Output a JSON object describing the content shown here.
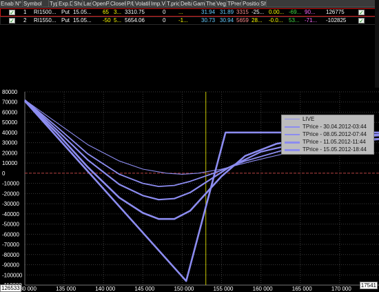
{
  "grid": {
    "headers": [
      "EnableN",
      "N°",
      "Symbol",
      "Type",
      "Exp.Date",
      "Share",
      "Last",
      "OpenPrice",
      "ClosePrice",
      "P/L",
      "Volatility",
      "Imp.Vol.",
      "T.price",
      "Delta",
      "Gamma",
      "Theta",
      "Vega",
      "TPremium",
      "Position",
      "Sh"
    ],
    "rows": [
      {
        "num": "1",
        "symbol": "RI1500...",
        "type": "Put",
        "exp": "15.05...",
        "share": "65",
        "last": "3...",
        "open": "3310.75",
        "close": "0",
        "pl": "...",
        "vol": "31.94",
        "impvol": "31.89",
        "tprice": "3315",
        "delta": "-25...",
        "gamma": "0.00...",
        "theta": "-69...",
        "vega": "90...",
        "tpremium": "126775"
      },
      {
        "num": "2",
        "symbol": "RI1550...",
        "type": "Put",
        "exp": "15.05...",
        "share": "-50",
        "last": "5...",
        "open": "5654.06",
        "close": "0",
        "pl": "-1...",
        "vol": "30.73",
        "impvol": "30.94",
        "tprice": "5659",
        "delta": "28...",
        "gamma": "-0.0...",
        "theta": "53...",
        "vega": "-71...",
        "tpremium": "-102825"
      }
    ]
  },
  "chart_data": {
    "type": "line",
    "x_range": [
      130000,
      175000
    ],
    "y_range": [
      -110000,
      80000
    ],
    "x_ticks": [
      "130 000",
      "135 000",
      "140 000",
      "145 000",
      "150 000",
      "155 000",
      "160 000",
      "165 000",
      "170 000"
    ],
    "x_tick_values": [
      130000,
      135000,
      140000,
      145000,
      150000,
      155000,
      160000,
      165000,
      170000
    ],
    "y_ticks": [
      "80000",
      "70000",
      "60000",
      "50000",
      "40000",
      "30000",
      "20000",
      "10000",
      "0",
      "-10000",
      "-20000",
      "-30000",
      "-40000",
      "-50000",
      "-60000",
      "-70000",
      "-80000",
      "-90000",
      "-100000",
      "-110000"
    ],
    "y_tick_values": [
      80000,
      70000,
      60000,
      50000,
      40000,
      30000,
      20000,
      10000,
      0,
      -10000,
      -20000,
      -30000,
      -40000,
      -50000,
      -60000,
      -70000,
      -80000,
      -90000,
      -100000,
      -110000
    ],
    "vertical_marker_x": 153000,
    "zero_line": 0,
    "cursor_x_label": "17541",
    "cursor_y_label": "126533",
    "legend_position": "top-right",
    "legend": [
      "LIVE",
      "TPrice - 30.04.2012-03:44",
      "TPrice - 08.05.2012-07:44",
      "TPrice - 11.05.2012-11:44",
      "TPrice - 15.05.2012-18:44"
    ],
    "series": [
      {
        "name": "TPrice - 15.05.2012-18:44",
        "width": 2.6,
        "points": [
          [
            130000,
            71000
          ],
          [
            150500,
            -106000
          ],
          [
            155500,
            40000
          ],
          [
            175000,
            40000
          ]
        ]
      },
      {
        "name": "TPrice - 11.05.2012-11:44",
        "width": 2.6,
        "points": [
          [
            130000,
            71000
          ],
          [
            134000,
            40000
          ],
          [
            138000,
            6000
          ],
          [
            142000,
            -24000
          ],
          [
            145000,
            -39000
          ],
          [
            147000,
            -45000
          ],
          [
            149000,
            -45000
          ],
          [
            151000,
            -37000
          ],
          [
            153000,
            -20000
          ],
          [
            155000,
            -3000
          ],
          [
            158000,
            17000
          ],
          [
            162000,
            29000
          ],
          [
            166000,
            34000
          ],
          [
            170000,
            36000
          ],
          [
            175000,
            38000
          ]
        ]
      },
      {
        "name": "TPrice - 08.05.2012-07:44",
        "width": 2.2,
        "points": [
          [
            130000,
            72000
          ],
          [
            134000,
            43000
          ],
          [
            138000,
            13000
          ],
          [
            142000,
            -11000
          ],
          [
            145000,
            -22000
          ],
          [
            147000,
            -26000
          ],
          [
            149000,
            -25000
          ],
          [
            151000,
            -19000
          ],
          [
            153000,
            -9000
          ],
          [
            156000,
            6000
          ],
          [
            160000,
            21000
          ],
          [
            165000,
            30000
          ],
          [
            170000,
            35000
          ],
          [
            175000,
            37000
          ]
        ]
      },
      {
        "name": "TPrice - 30.04.2012-03:44",
        "width": 1.8,
        "points": [
          [
            130000,
            72000
          ],
          [
            134000,
            46000
          ],
          [
            138000,
            19000
          ],
          [
            142000,
            -1000
          ],
          [
            145000,
            -10000
          ],
          [
            147000,
            -13000
          ],
          [
            149000,
            -12000
          ],
          [
            151000,
            -8000
          ],
          [
            154000,
            0
          ],
          [
            158000,
            12000
          ],
          [
            163000,
            23000
          ],
          [
            168000,
            30000
          ],
          [
            175000,
            34000
          ]
        ]
      },
      {
        "name": "LIVE",
        "width": 1.1,
        "points": [
          [
            130000,
            72000
          ],
          [
            134000,
            50000
          ],
          [
            138000,
            28000
          ],
          [
            142000,
            12000
          ],
          [
            145000,
            4000
          ],
          [
            148000,
            0
          ],
          [
            150000,
            -1000
          ],
          [
            152000,
            0
          ],
          [
            155000,
            4000
          ],
          [
            159000,
            12000
          ],
          [
            164000,
            21000
          ],
          [
            169000,
            28000
          ],
          [
            175000,
            33000
          ]
        ]
      }
    ],
    "colors": {
      "series": "#8c8cf0",
      "zero_line": "#b84040",
      "marker": "#c8c800",
      "grid": "#3c3c3c",
      "legend_bg": "#bdbdbd"
    }
  }
}
